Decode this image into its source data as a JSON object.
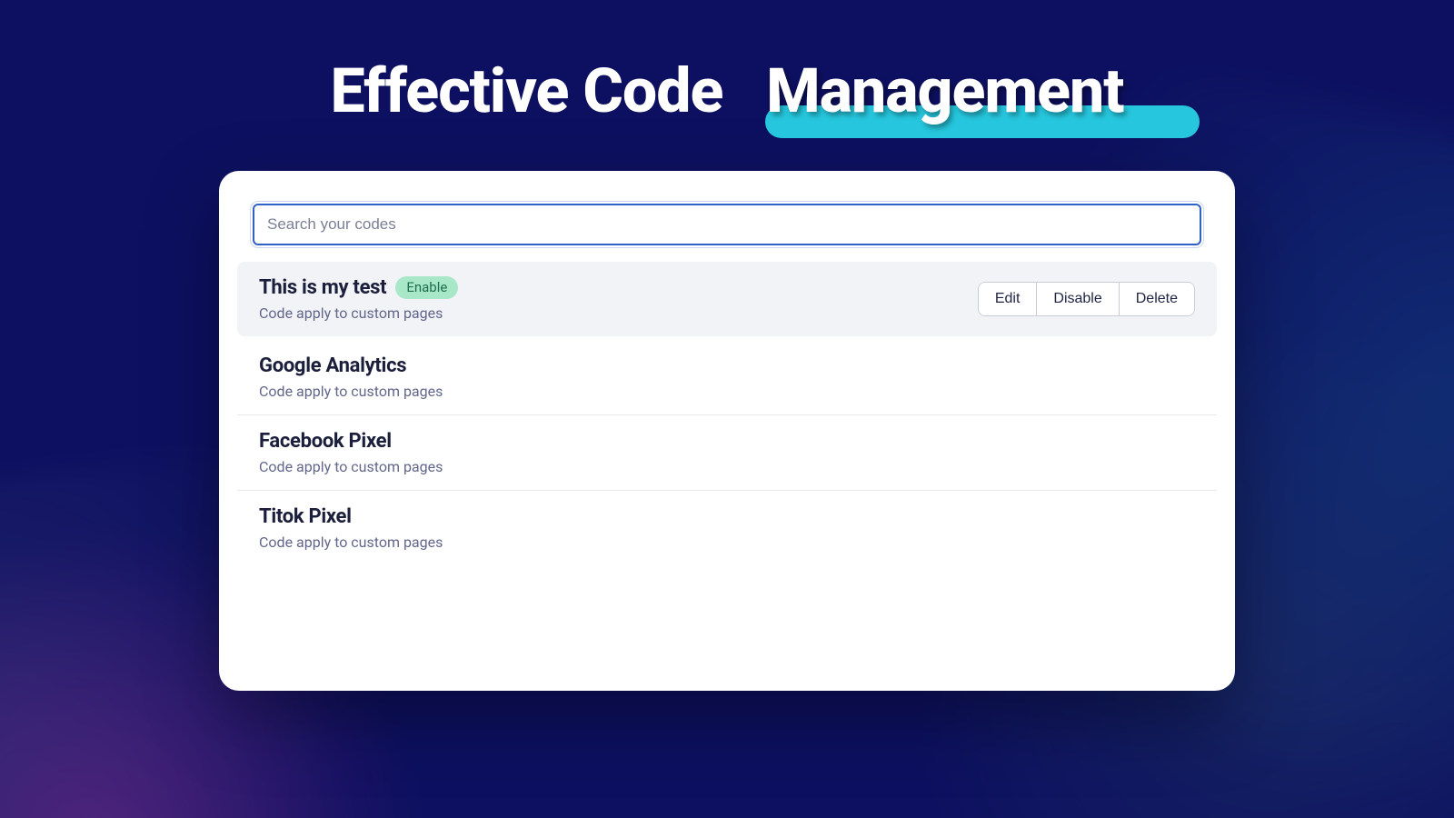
{
  "hero": {
    "word1": "Effective Code",
    "word2": "Management"
  },
  "search": {
    "placeholder": "Search your codes",
    "value": ""
  },
  "rows": [
    {
      "title": "This is my test",
      "subtitle": "Code apply to custom pages",
      "badge": "Enable",
      "selected": true,
      "actions": {
        "edit": "Edit",
        "disable": "Disable",
        "delete": "Delete"
      }
    },
    {
      "title": "Google Analytics",
      "subtitle": "Code apply to custom pages",
      "selected": false
    },
    {
      "title": "Facebook Pixel",
      "subtitle": "Code apply to custom pages",
      "selected": false
    },
    {
      "title": "Titok Pixel",
      "subtitle": "Code apply to custom pages",
      "selected": false
    }
  ]
}
